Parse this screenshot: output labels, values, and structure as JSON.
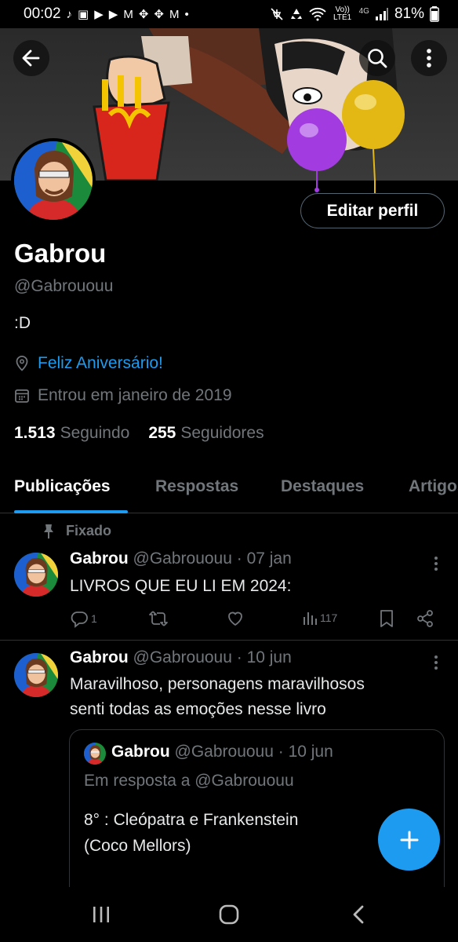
{
  "status_bar": {
    "time": "00:02",
    "notification_icons": [
      "♪",
      "▣",
      "▶",
      "▶",
      "M",
      "✥",
      "✥",
      "M",
      "•"
    ],
    "system_icons": [
      "mute",
      "recycle",
      "wifi"
    ],
    "volte": "Vo)) LTE1",
    "network": "4G",
    "battery_percent": "81%"
  },
  "header": {
    "back_icon": "arrow-left-icon",
    "search_icon": "search-icon",
    "more_icon": "vertical-dots-icon"
  },
  "profile": {
    "edit_label": "Editar perfil",
    "name": "Gabrou",
    "handle": "@Gabrououu",
    "bio": ":D",
    "location": "Feliz Aniversário!",
    "joined": "Entrou em janeiro de 2019",
    "following_count": "1.513",
    "following_label": "Seguindo",
    "followers_count": "255",
    "followers_label": "Seguidores"
  },
  "tabs": [
    "Publicações",
    "Respostas",
    "Destaques",
    "Artigos"
  ],
  "pinned_label": "Fixado",
  "posts": [
    {
      "name": "Gabrou",
      "meta": "@Gabrououu · 07 jan",
      "text": "LIVROS QUE EU LI EM 2024:",
      "replies": "1",
      "retweets": "",
      "likes": "",
      "views": "117"
    },
    {
      "name": "Gabrou",
      "meta": "@Gabrououu · 10 jun",
      "text_line1": "Maravilhoso, personagens maravilhosos",
      "text_line2": "senti todas as emoções nesse livro"
    }
  ],
  "quote": {
    "name": "Gabrou",
    "meta": "@Gabrououu · 10 jun",
    "reply_to": "Em resposta a @Gabrououu",
    "text_line1": "8° : Cleópatra e Frankenstein",
    "text_line2": "(Coco Mellors)"
  },
  "colors": {
    "accent": "#1d9bf0",
    "muted": "#71767b",
    "divider": "#2f3336",
    "background": "#000000"
  }
}
